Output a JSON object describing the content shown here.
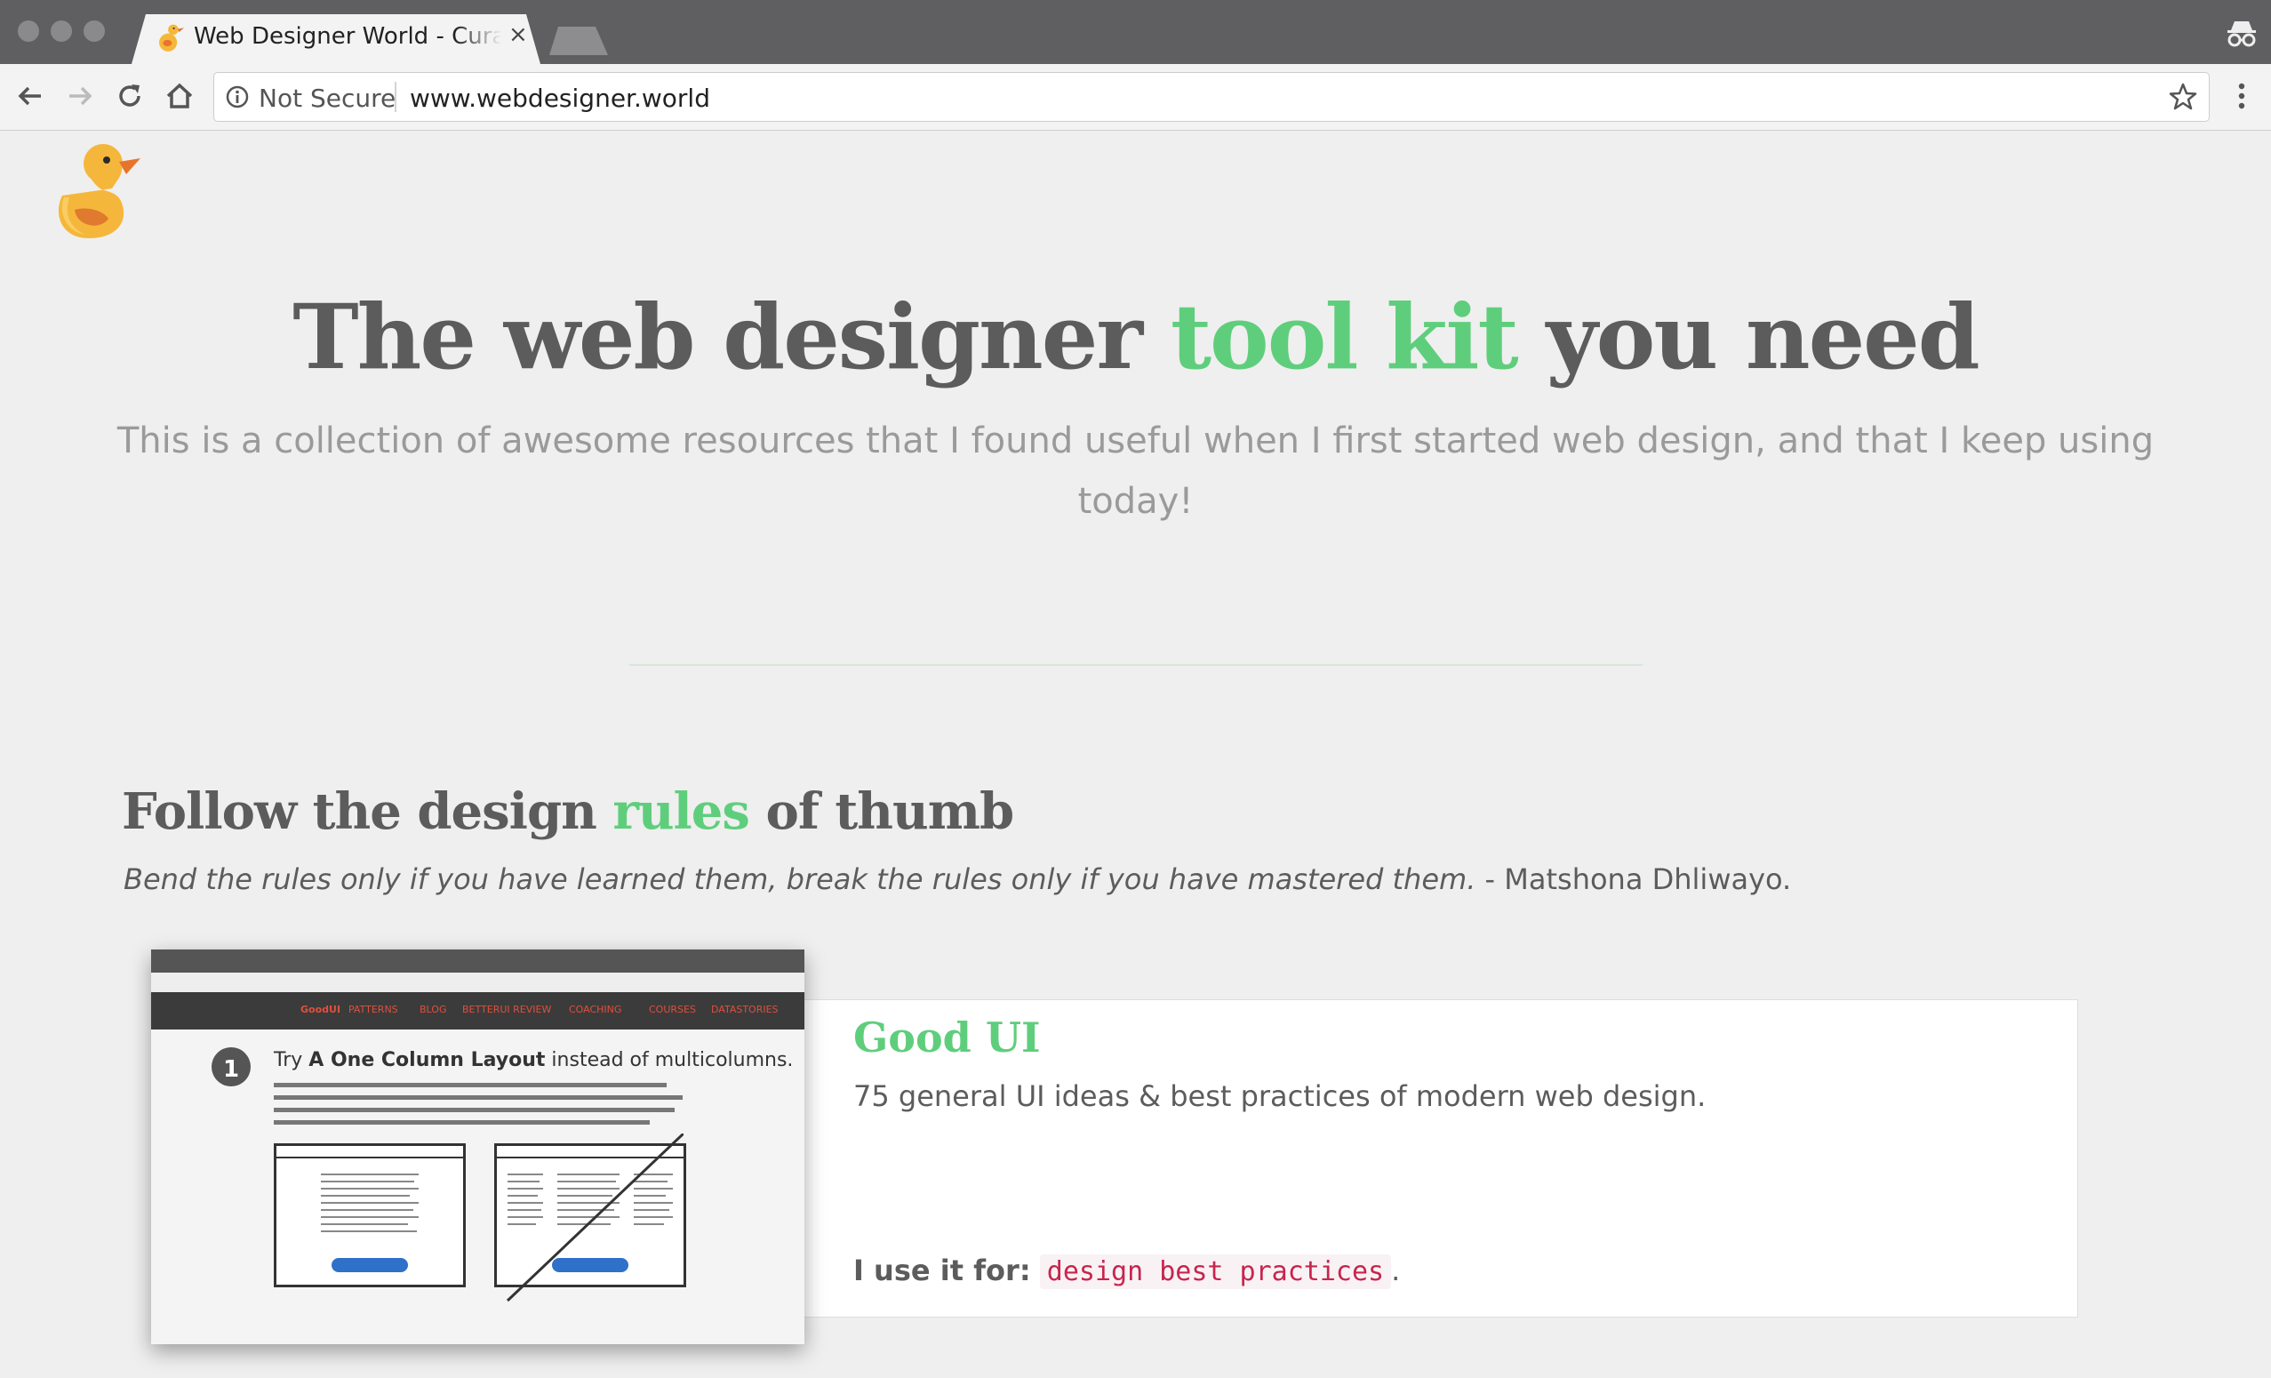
{
  "browser": {
    "tab_title": "Web Designer World - Curated",
    "tab_close": "×",
    "security_label": "Not Secure",
    "url": "www.webdesigner.world"
  },
  "hero": {
    "title_before": "The web designer ",
    "title_accent": "tool kit",
    "title_after": " you need",
    "subtitle": "This is a collection of awesome resources that I found useful when I first started web design, and that I keep using today!"
  },
  "section": {
    "title_before": "Follow the design ",
    "title_accent": "rules",
    "title_after": " of thumb",
    "quote_text": "Bend the rules only if you have learned them, break the rules only if you have mastered them.",
    "quote_author": " - Matshona Dhliwayo."
  },
  "card": {
    "title": "Good UI",
    "description": "75 general UI ideas & best practices of modern web design.",
    "use_label": "I use it for:",
    "use_value": "design best practices",
    "use_suffix": "."
  },
  "thumbnail": {
    "brand": "GoodUI",
    "nav": [
      "PATTERNS",
      "BLOG",
      "BETTERUI REVIEW",
      "COACHING",
      "COURSES",
      "DATASTORIES"
    ],
    "badge_number": "1",
    "heading_before": "Try ",
    "heading_bold": "A One Column Layout",
    "heading_after": " instead of multicolumns."
  },
  "colors": {
    "accent": "#5fce7c",
    "text": "#5c5c5c",
    "muted": "#9a9a9a",
    "code": "#c7254e"
  },
  "icons": [
    "duck-logo-icon",
    "back-arrow-icon",
    "forward-arrow-icon",
    "reload-icon",
    "home-icon",
    "info-icon",
    "star-icon",
    "menu-icon",
    "incognito-icon"
  ]
}
